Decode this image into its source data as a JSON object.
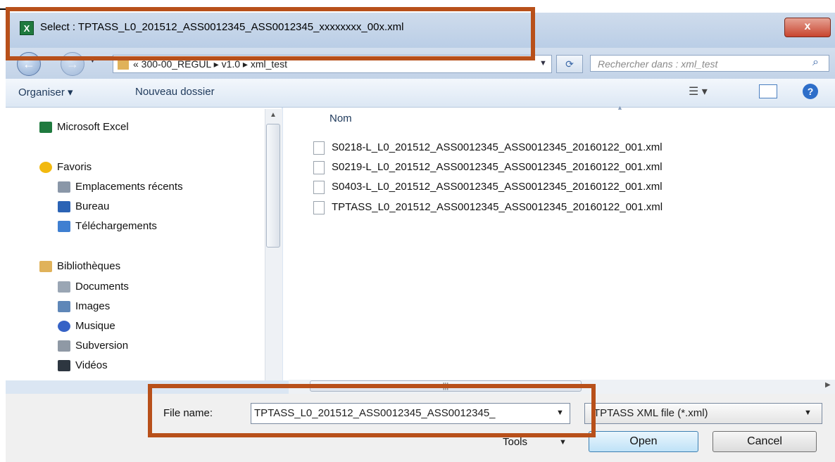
{
  "window": {
    "title": "Select : TPTASS_L0_201512_ASS0012345_ASS0012345_xxxxxxxx_00x.xml",
    "close_label": "x"
  },
  "nav": {
    "back_glyph": "←",
    "forward_glyph": "→",
    "address_path": "« 300-00_REGUL ▸ v1.0 ▸ xml_test",
    "search_placeholder": "Rechercher dans : xml_test"
  },
  "toolbar": {
    "organise": "Organiser ▾",
    "new_folder": "Nouveau dossier"
  },
  "sidebar": {
    "items": [
      {
        "label": "Microsoft Excel",
        "icon": "excel-icon",
        "color": "#1f7a3e"
      },
      {
        "label": "Favoris",
        "icon": "star-icon",
        "color": "#f2b90f"
      },
      {
        "label": "Emplacements récents",
        "icon": "recent-places-icon",
        "color": "#8a97a8"
      },
      {
        "label": "Bureau",
        "icon": "desktop-icon",
        "color": "#2b63b5"
      },
      {
        "label": "Téléchargements",
        "icon": "downloads-icon",
        "color": "#3f7fd1"
      },
      {
        "label": "Bibliothèques",
        "icon": "libraries-icon",
        "color": "#e0b25a"
      },
      {
        "label": "Documents",
        "icon": "documents-icon",
        "color": "#9aa6b4"
      },
      {
        "label": "Images",
        "icon": "images-icon",
        "color": "#5f87b8"
      },
      {
        "label": "Musique",
        "icon": "music-icon",
        "color": "#3562c6"
      },
      {
        "label": "Subversion",
        "icon": "subversion-icon",
        "color": "#8f99a5"
      },
      {
        "label": "Vidéos",
        "icon": "videos-icon",
        "color": "#2d3640"
      }
    ]
  },
  "file_list": {
    "column_header": "Nom",
    "files": [
      "S0218-L_L0_201512_ASS0012345_ASS0012345_20160122_001.xml",
      "S0219-L_L0_201512_ASS0012345_ASS0012345_20160122_001.xml",
      "S0403-L_L0_201512_ASS0012345_ASS0012345_20160122_001.xml",
      "TPTASS_L0_201512_ASS0012345_ASS0012345_20160122_001.xml"
    ]
  },
  "footer": {
    "file_name_label": "File name:",
    "file_name_value": "TPTASS_L0_201512_ASS0012345_ASS0012345_",
    "file_type_value": "TPTASS XML file  (*.xml)",
    "tools_label": "Tools",
    "open_label": "Open",
    "cancel_label": "Cancel"
  },
  "highlight_color": "#b8501a"
}
